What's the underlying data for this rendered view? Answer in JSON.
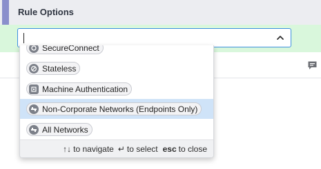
{
  "header": {
    "title": "Rule Options"
  },
  "select": {
    "value": ""
  },
  "dropdown": {
    "options": [
      {
        "label": "SecureConnect",
        "icon": "secureconnect-icon"
      },
      {
        "label": "Stateless",
        "icon": "stateless-icon"
      },
      {
        "label": "Machine Authentication",
        "icon": "machine-auth-icon"
      },
      {
        "label": "Non-Corporate Networks (Endpoints Only)",
        "icon": "network-icon",
        "highlighted": true
      },
      {
        "label": "All Networks",
        "icon": "network-icon"
      }
    ],
    "footer": {
      "navigate_keys": "↑↓",
      "navigate_text": "to navigate",
      "select_key": "↵",
      "select_text": "to select",
      "close_key": "esc",
      "close_text": "to close"
    }
  },
  "colors": {
    "header_bg": "#ecedf1",
    "accent": "#8a8fcc",
    "band_bg": "#d9f7dc",
    "focus_border": "#3b8edf",
    "highlight": "#cfe3f8"
  }
}
